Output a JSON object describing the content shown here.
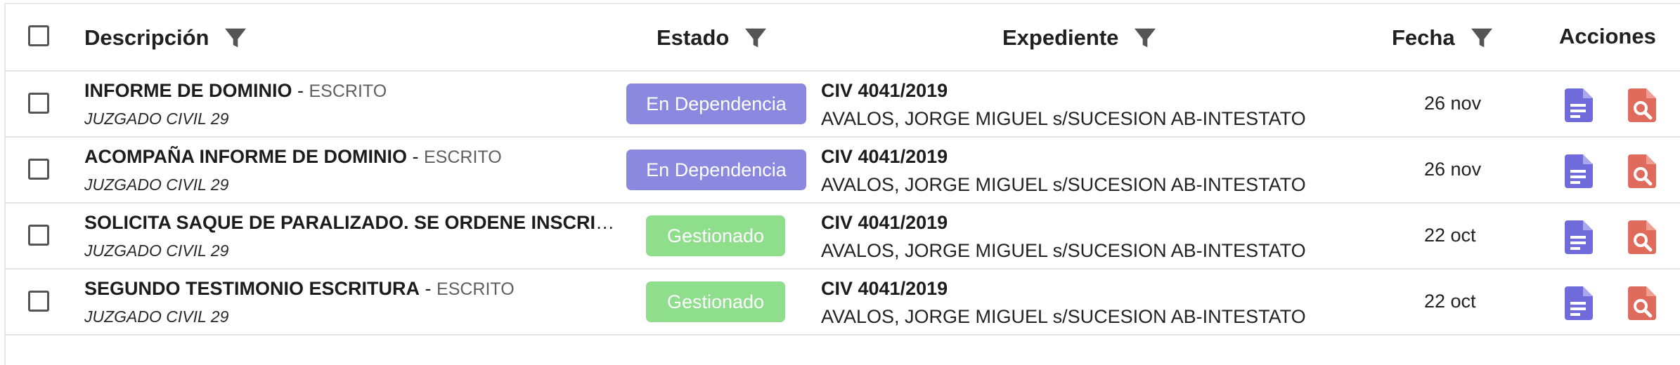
{
  "header": {
    "descripcion": "Descripción",
    "estado": "Estado",
    "expediente": "Expediente",
    "fecha": "Fecha",
    "acciones": "Acciones"
  },
  "icons": {
    "filter": "filter-icon",
    "document": "document-icon",
    "search_document": "search-document-icon"
  },
  "colors": {
    "en_dependencia": "#8b88e0",
    "gestionado": "#8ede8c",
    "doc_action": "#6f6bdb",
    "search_action": "#de6b5b",
    "filter_icon": "#555555"
  },
  "rows": [
    {
      "title": "INFORME DE DOMINIO",
      "type": "ESCRITO",
      "court": "JUZGADO CIVIL 29",
      "status": "En Dependencia",
      "expediente_num": "CIV 4041/2019",
      "caratula": "AVALOS, JORGE MIGUEL s/SUCESION AB-INTESTATO",
      "fecha": "26 nov"
    },
    {
      "title": "ACOMPAÑA INFORME DE DOMINIO",
      "type": "ESCRITO",
      "court": "JUZGADO CIVIL 29",
      "status": "En Dependencia",
      "expediente_num": "CIV 4041/2019",
      "caratula": "AVALOS, JORGE MIGUEL s/SUCESION AB-INTESTATO",
      "fecha": "26 nov"
    },
    {
      "title": "SOLICITA SAQUE DE PARALIZADO. SE ORDENE INSCRIP...",
      "type": "",
      "court": "JUZGADO CIVIL 29",
      "status": "Gestionado",
      "expediente_num": "CIV 4041/2019",
      "caratula": "AVALOS, JORGE MIGUEL s/SUCESION AB-INTESTATO",
      "fecha": "22 oct"
    },
    {
      "title": "SEGUNDO TESTIMONIO ESCRITURA",
      "type": "ESCRITO",
      "court": "JUZGADO CIVIL 29",
      "status": "Gestionado",
      "expediente_num": "CIV 4041/2019",
      "caratula": "AVALOS, JORGE MIGUEL s/SUCESION AB-INTESTATO",
      "fecha": "22 oct"
    }
  ]
}
